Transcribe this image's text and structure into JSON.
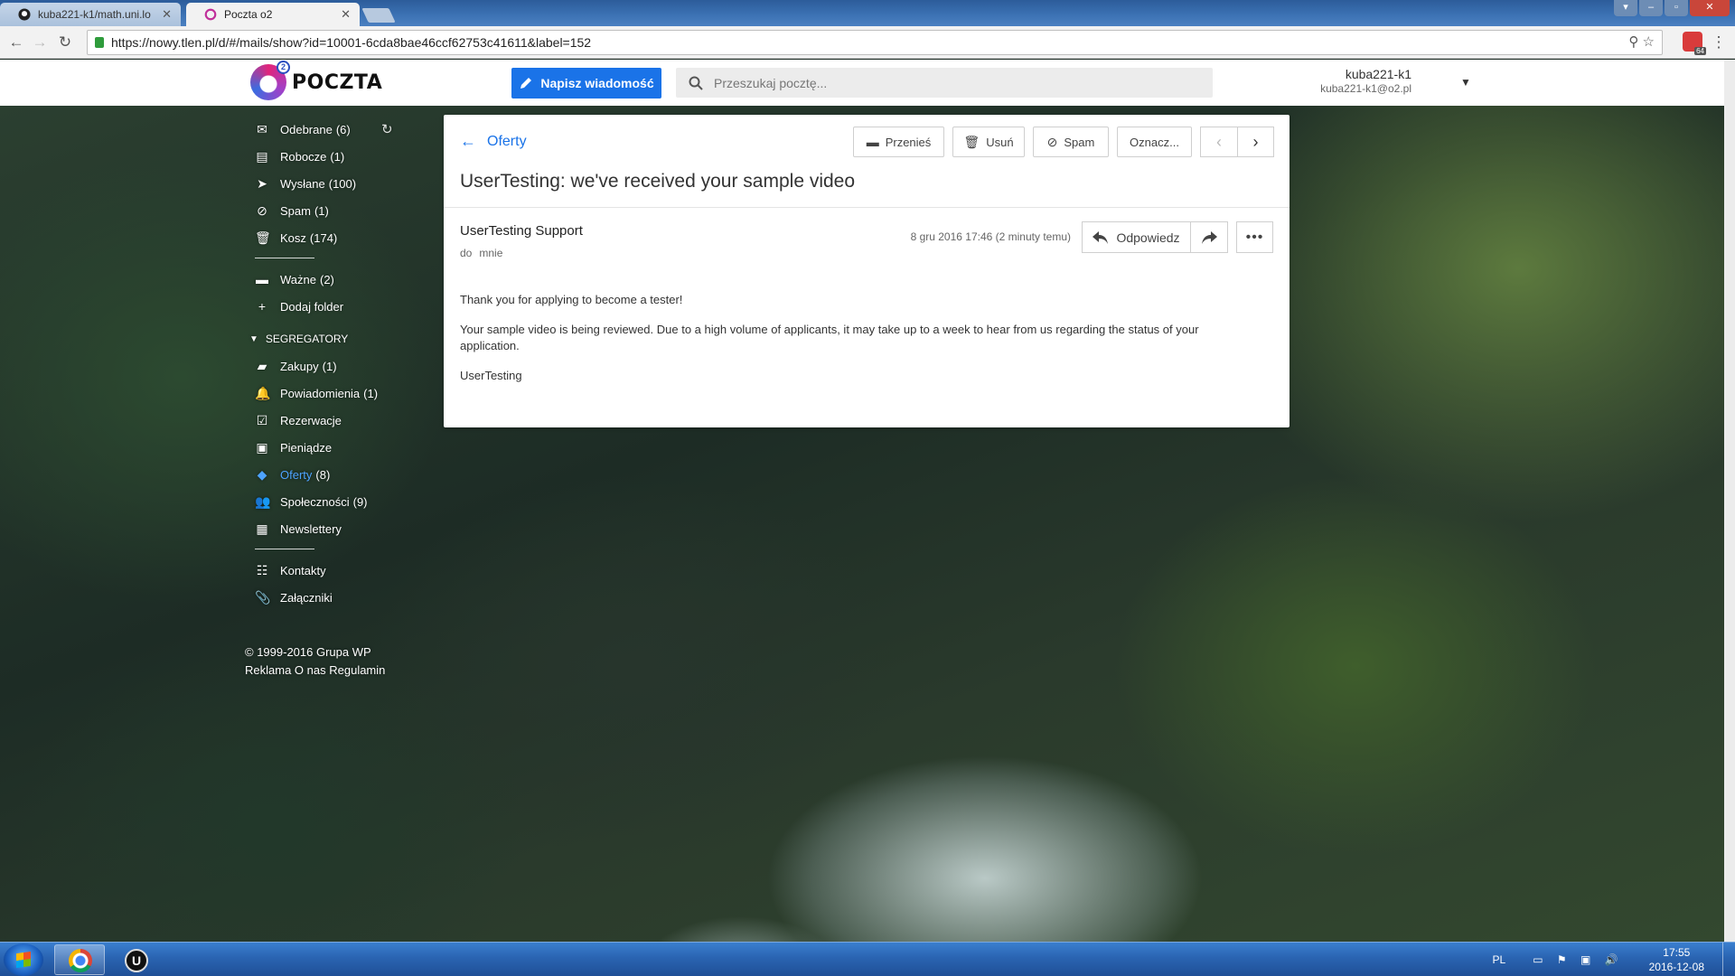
{
  "browser": {
    "tabs": [
      {
        "label": "kuba221-k1/math.uni.lo",
        "active": false
      },
      {
        "label": "Poczta o2",
        "active": true
      }
    ],
    "url": "https://nowy.tlen.pl/d/#/mails/show?id=10001-6cda8bae46ccf62753c41611&label=152"
  },
  "header": {
    "logo_text": "POCZTA",
    "logo_badge": "2",
    "compose_label": "Napisz wiadomość",
    "search_placeholder": "Przeszukaj pocztę...",
    "user_name": "kuba221-k1",
    "user_email": "kuba221-k1@o2.pl"
  },
  "sidebar": {
    "folders": [
      {
        "label": "Odebrane",
        "count": "(6)",
        "icon": "envelope-icon"
      },
      {
        "label": "Robocze",
        "count": "(1)",
        "icon": "draft-icon"
      },
      {
        "label": "Wysłane",
        "count": "(100)",
        "icon": "send-icon"
      },
      {
        "label": "Spam",
        "count": "(1)",
        "icon": "spam-icon"
      },
      {
        "label": "Kosz",
        "count": "(174)",
        "icon": "trash-icon"
      }
    ],
    "custom": [
      {
        "label": "Ważne",
        "count": "(2)",
        "icon": "folder-icon"
      },
      {
        "label": "Dodaj folder",
        "count": "",
        "icon": "plus-icon"
      }
    ],
    "group_label": "SEGREGATORY",
    "binders": [
      {
        "label": "Zakupy",
        "count": "(1)",
        "icon": "bag-icon"
      },
      {
        "label": "Powiadomienia",
        "count": "(1)",
        "icon": "bell-icon"
      },
      {
        "label": "Rezerwacje",
        "count": "",
        "icon": "calendar-icon"
      },
      {
        "label": "Pieniądze",
        "count": "",
        "icon": "money-icon"
      },
      {
        "label": "Oferty",
        "count": "(8)",
        "icon": "tag-icon",
        "active": true
      },
      {
        "label": "Społeczności",
        "count": "(9)",
        "icon": "people-icon"
      },
      {
        "label": "Newslettery",
        "count": "",
        "icon": "newspaper-icon"
      }
    ],
    "extras": [
      {
        "label": "Kontakty",
        "icon": "contacts-icon"
      },
      {
        "label": "Załączniki",
        "icon": "paperclip-icon"
      }
    ],
    "footer": {
      "copyright": "© 1999-2016 Grupa WP",
      "links": [
        "Reklama",
        "O nas",
        "Regulamin"
      ]
    }
  },
  "email": {
    "back_label": "Oferty",
    "actions": {
      "move": "Przenieś",
      "delete": "Usuń",
      "spam": "Spam",
      "mark": "Oznacz..."
    },
    "subject": "UserTesting: we've received your sample video",
    "sender": "UserTesting Support",
    "to_prefix": "do",
    "to": "mnie",
    "date": "8 gru 2016 17:46 (2 minuty temu)",
    "reply_label": "Odpowiedz",
    "body": [
      "Thank you for applying to become a tester!",
      "Your sample video is being reviewed. Due to a high volume of applicants, it may take up to a week to hear from us regarding the status of your application.",
      "UserTesting"
    ]
  },
  "taskbar": {
    "language": "PL",
    "time": "17:55",
    "date": "2016-12-08",
    "ext_badge": "64"
  },
  "colors": {
    "accent": "#1a73e8",
    "active_folder": "#4da3ff"
  }
}
